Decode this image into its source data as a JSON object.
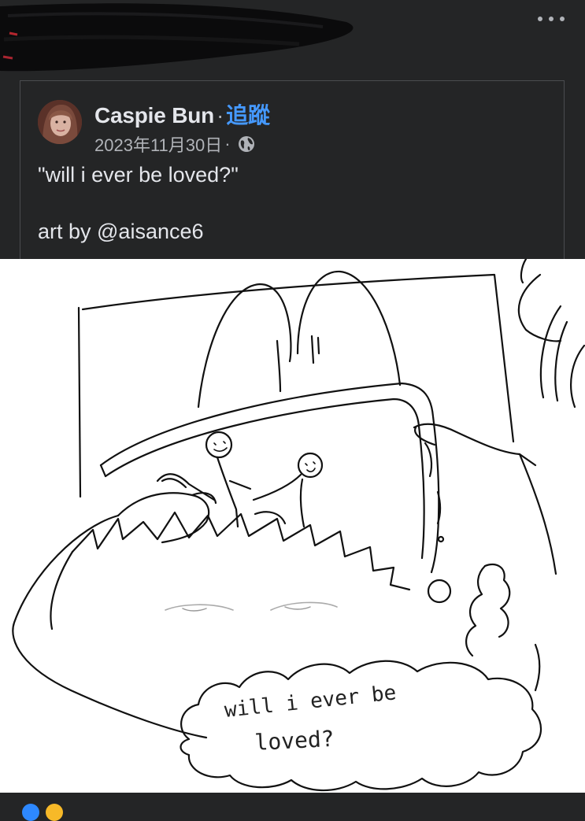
{
  "post": {
    "author": {
      "name": "Caspie Bun",
      "separator": "·",
      "follow_label": "追蹤",
      "avatar_icon": "profile-photo"
    },
    "date": "2023年11月30日",
    "meta_separator": "·",
    "audience_icon": "globe-icon",
    "text": "\"will i ever be loved?\"",
    "credit": "art by @aisance6"
  },
  "artwork": {
    "speech_text": [
      "will i ever be",
      "loved?"
    ]
  },
  "menu": {
    "icon": "more-dots-icon"
  },
  "colors": {
    "background": "#242526",
    "text": "#e4e6eb",
    "secondary_text": "#b0b3b8",
    "link": "#4599ff",
    "border": "#4a4c4f"
  }
}
